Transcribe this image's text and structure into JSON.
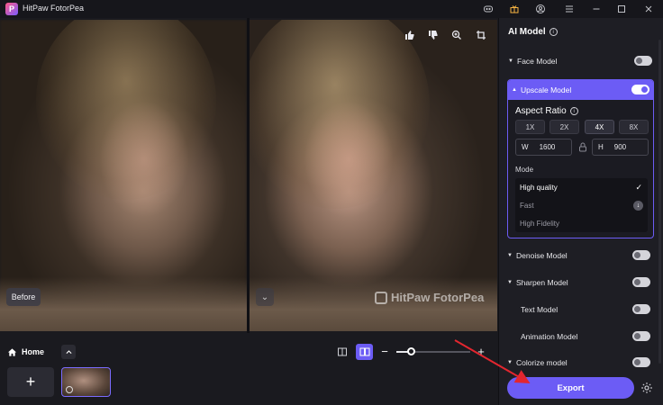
{
  "app": {
    "title": "HitPaw FotorPea",
    "logo_letter": "P",
    "accent_color": "#6c5cf5"
  },
  "titlebar": {
    "icons": [
      "discord-icon",
      "gift-icon",
      "account-icon",
      "menu-icon",
      "minimize-icon",
      "maximize-icon",
      "close-icon"
    ]
  },
  "preview": {
    "before_label": "Before",
    "watermark": "HitPaw FotorPea",
    "overlay_icons": [
      "thumbs-up-icon",
      "thumbs-down-icon",
      "zoom-icon",
      "crop-icon"
    ]
  },
  "bottom": {
    "home_label": "Home",
    "add_symbol": "+",
    "zoom_minus": "−",
    "zoom_plus": "+",
    "zoom_level": 0.2
  },
  "panel": {
    "title": "AI Model",
    "models": [
      {
        "label": "Face Model",
        "enabled": false
      },
      {
        "label": "Upscale Model",
        "enabled": true
      },
      {
        "label": "Denoise Model",
        "enabled": false
      },
      {
        "label": "Sharpen Model",
        "enabled": false
      },
      {
        "label": "Text Model",
        "enabled": false
      },
      {
        "label": "Animation Model",
        "enabled": false
      },
      {
        "label": "Colorize model",
        "enabled": false
      }
    ],
    "upscale": {
      "aspect_title": "Aspect Ratio",
      "scales": [
        "1X",
        "2X",
        "4X",
        "8X"
      ],
      "selected_scale": "4X",
      "width_label": "W",
      "width_value": "1600",
      "height_label": "H",
      "height_value": "900",
      "mode_label": "Mode",
      "modes": [
        "High quality",
        "Fast",
        "High Fidelity"
      ],
      "selected_mode": "High quality"
    },
    "export_label": "Export"
  }
}
